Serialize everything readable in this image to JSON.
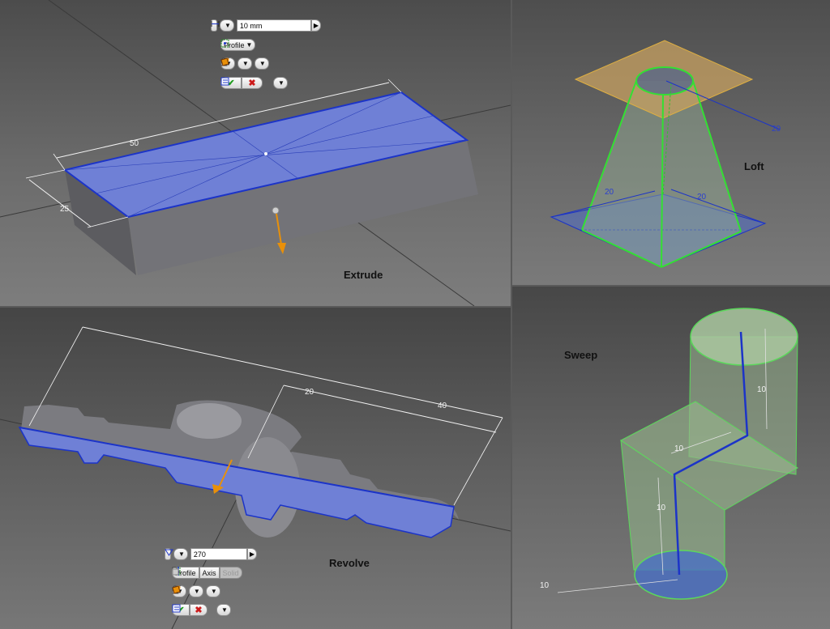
{
  "panels": {
    "extrude": {
      "caption": "Extrude",
      "dimensions": {
        "length": "50",
        "width": "25"
      },
      "minitoolbar": {
        "distance_value": "10 mm",
        "profile_label": "Profile"
      }
    },
    "loft": {
      "caption": "Loft",
      "dimensions": {
        "side_a": "20",
        "side_b": "20",
        "offset": "20"
      }
    },
    "revolve": {
      "caption": "Revolve",
      "dimensions": {
        "overall": "40",
        "partial": "20"
      },
      "minitoolbar": {
        "angle_value": "270",
        "profile_label": "Profile",
        "axis_label": "Axis",
        "solid_label": "Solid"
      }
    },
    "sweep": {
      "caption": "Sweep",
      "dimensions": {
        "top_leg": "10",
        "middle_leg": "10",
        "bottom_leg": "10",
        "diameter": "10"
      }
    }
  },
  "colors": {
    "profile_fill": "#6f80d6",
    "profile_edge": "#1c34c8",
    "solid_gray": "#8c8c90",
    "loft_edge": "#33e033",
    "sketch_plane": "#c7a060",
    "arrow": "#e8900a",
    "ok_green": "#1f9a1f",
    "cancel_red": "#cc1a1a"
  },
  "icons": [
    "dimension-icon",
    "profile-icon",
    "output-icon",
    "operation-icon",
    "face-icon",
    "ok-icon",
    "cancel-icon",
    "options-icon",
    "play-icon",
    "direction-icon",
    "axis-icon",
    "solid-icon"
  ]
}
